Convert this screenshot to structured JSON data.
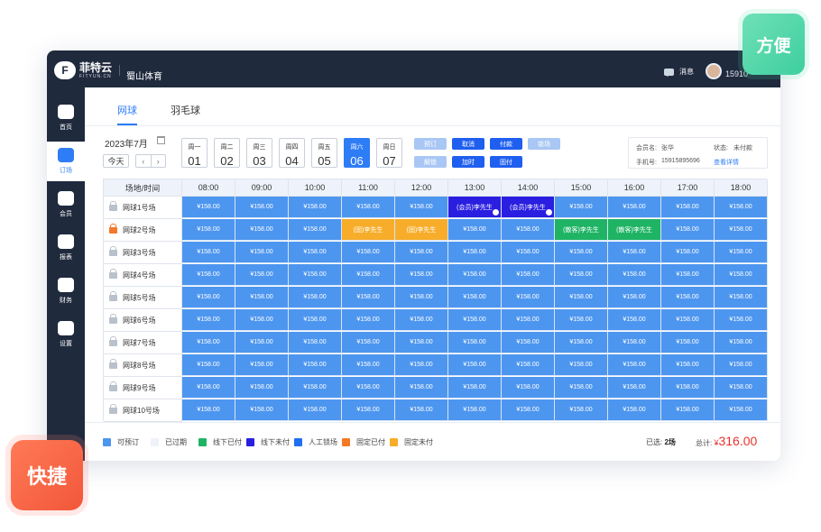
{
  "app": {
    "brand_cn": "菲特云",
    "brand_en": "FITYUN.CN",
    "venue": "蜀山体育",
    "messages_label": "消息",
    "phone": "15910"
  },
  "sidebar": {
    "items": [
      {
        "label": "首页",
        "icon": "cloud-icon"
      },
      {
        "label": "订场",
        "icon": "book-icon",
        "active": true
      },
      {
        "label": "会员",
        "icon": "wallet-icon"
      },
      {
        "label": "报表",
        "icon": "pie-chart-icon"
      },
      {
        "label": "财务",
        "icon": "yen-icon"
      },
      {
        "label": "设置",
        "icon": "gear-icon"
      }
    ]
  },
  "tabs": [
    {
      "label": "网球",
      "active": true
    },
    {
      "label": "羽毛球"
    }
  ],
  "month": "2023年7月",
  "today_label": "今天",
  "nav": {
    "prev": "‹",
    "next": "›"
  },
  "days": [
    {
      "week": "周一",
      "num": "01"
    },
    {
      "week": "周二",
      "num": "02"
    },
    {
      "week": "周三",
      "num": "03"
    },
    {
      "week": "周四",
      "num": "04"
    },
    {
      "week": "周五",
      "num": "05"
    },
    {
      "week": "周六",
      "num": "06",
      "active": true
    },
    {
      "week": "周日",
      "num": "07"
    }
  ],
  "actions": {
    "row1": [
      "预订",
      "取消",
      "付款",
      "锁场"
    ],
    "row2": [
      "解锁",
      "加时",
      "固付"
    ]
  },
  "member": {
    "name_label": "会员名:",
    "name": "张华",
    "status_label": "状态:",
    "status": "未付款",
    "phone_label": "手机号:",
    "phone": "15915895696",
    "details_link": "查看详情"
  },
  "grid": {
    "corner": "场地/时间",
    "times": [
      "08:00",
      "09:00",
      "10:00",
      "11:00",
      "12:00",
      "13:00",
      "14:00",
      "15:00",
      "16:00",
      "17:00",
      "18:00"
    ],
    "courts": [
      "网球1号场",
      "网球2号场",
      "网球3号场",
      "网球4号场",
      "网球5号场",
      "网球6号场",
      "网球7号场",
      "网球8号场",
      "网球9号场",
      "网球10号场"
    ],
    "price": "¥158.00",
    "special": [
      {
        "court": 0,
        "slot": 5,
        "text": "(会员)李先生",
        "status": "offline-unpaid"
      },
      {
        "court": 0,
        "slot": 6,
        "text": "(会员)李先生",
        "status": "offline-unpaid"
      },
      {
        "court": 1,
        "slot": 3,
        "text": "(固)李先生",
        "status": "fixed-unpaid"
      },
      {
        "court": 1,
        "slot": 4,
        "text": "(固)李先生",
        "status": "fixed-unpaid"
      },
      {
        "court": 1,
        "slot": 7,
        "text": "(散客)李先生",
        "status": "offline-paid"
      },
      {
        "court": 1,
        "slot": 8,
        "text": "(散客)李先生",
        "status": "offline-paid"
      }
    ],
    "locked_court": 1
  },
  "colors": {
    "available": "#4d96ef",
    "expired": "#eef3fb",
    "offline-paid": "#1fb464",
    "offline-unpaid": "#2a1fe0",
    "manual-lock": "#1f6ff0",
    "fixed-paid": "#f57a23",
    "fixed-unpaid": "#f7ad2a"
  },
  "legend": [
    {
      "label": "可预订",
      "key": "available"
    },
    {
      "label": "已过期",
      "key": "expired"
    },
    {
      "label": "线下已付",
      "key": "offline-paid"
    },
    {
      "label": "线下未付",
      "key": "offline-unpaid"
    },
    {
      "label": "人工锁场",
      "key": "manual-lock"
    },
    {
      "label": "固定已付",
      "key": "fixed-paid"
    },
    {
      "label": "固定未付",
      "key": "fixed-unpaid"
    }
  ],
  "summary": {
    "selected_label": "已选:",
    "selected_value": "2场",
    "total_label": "总计:",
    "currency": "¥",
    "total": "316.00"
  },
  "badges": {
    "fast": "快捷",
    "convenient": "方便"
  }
}
